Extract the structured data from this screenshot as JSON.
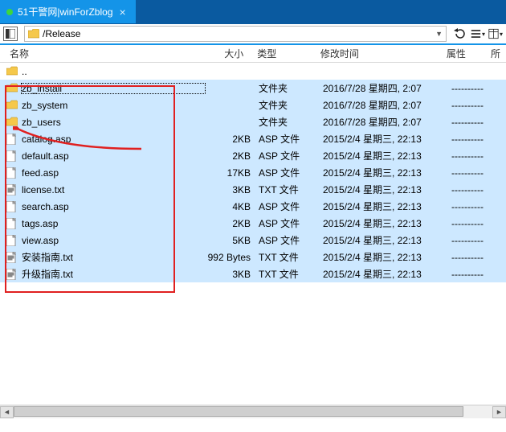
{
  "tab": {
    "title": "51干警网|winForZblog"
  },
  "path": "/Release",
  "columns": {
    "name": "名称",
    "size": "大小",
    "type": "类型",
    "mtime": "修改时间",
    "attr": "属性",
    "owner": "所"
  },
  "parent_row": "..",
  "rows": [
    {
      "icon": "folder",
      "name": "zb_install",
      "size": "",
      "type": "文件夹",
      "mtime": "2016/7/28 星期四, 2:07",
      "attr": "----------",
      "selected": true,
      "focused": true
    },
    {
      "icon": "folder",
      "name": "zb_system",
      "size": "",
      "type": "文件夹",
      "mtime": "2016/7/28 星期四, 2:07",
      "attr": "----------",
      "selected": true
    },
    {
      "icon": "folder",
      "name": "zb_users",
      "size": "",
      "type": "文件夹",
      "mtime": "2016/7/28 星期四, 2:07",
      "attr": "----------",
      "selected": true
    },
    {
      "icon": "file",
      "name": "catalog.asp",
      "size": "2KB",
      "type": "ASP 文件",
      "mtime": "2015/2/4 星期三, 22:13",
      "attr": "----------",
      "selected": true
    },
    {
      "icon": "file",
      "name": "default.asp",
      "size": "2KB",
      "type": "ASP 文件",
      "mtime": "2015/2/4 星期三, 22:13",
      "attr": "----------",
      "selected": true
    },
    {
      "icon": "file",
      "name": "feed.asp",
      "size": "17KB",
      "type": "ASP 文件",
      "mtime": "2015/2/4 星期三, 22:13",
      "attr": "----------",
      "selected": true
    },
    {
      "icon": "txt",
      "name": "license.txt",
      "size": "3KB",
      "type": "TXT 文件",
      "mtime": "2015/2/4 星期三, 22:13",
      "attr": "----------",
      "selected": true
    },
    {
      "icon": "file",
      "name": "search.asp",
      "size": "4KB",
      "type": "ASP 文件",
      "mtime": "2015/2/4 星期三, 22:13",
      "attr": "----------",
      "selected": true
    },
    {
      "icon": "file",
      "name": "tags.asp",
      "size": "2KB",
      "type": "ASP 文件",
      "mtime": "2015/2/4 星期三, 22:13",
      "attr": "----------",
      "selected": true
    },
    {
      "icon": "file",
      "name": "view.asp",
      "size": "5KB",
      "type": "ASP 文件",
      "mtime": "2015/2/4 星期三, 22:13",
      "attr": "----------",
      "selected": true
    },
    {
      "icon": "txt",
      "name": "安装指南.txt",
      "size": "992 Bytes",
      "type": "TXT 文件",
      "mtime": "2015/2/4 星期三, 22:13",
      "attr": "----------",
      "selected": true
    },
    {
      "icon": "txt",
      "name": "升级指南.txt",
      "size": "3KB",
      "type": "TXT 文件",
      "mtime": "2015/2/4 星期三, 22:13",
      "attr": "----------",
      "selected": true
    }
  ]
}
